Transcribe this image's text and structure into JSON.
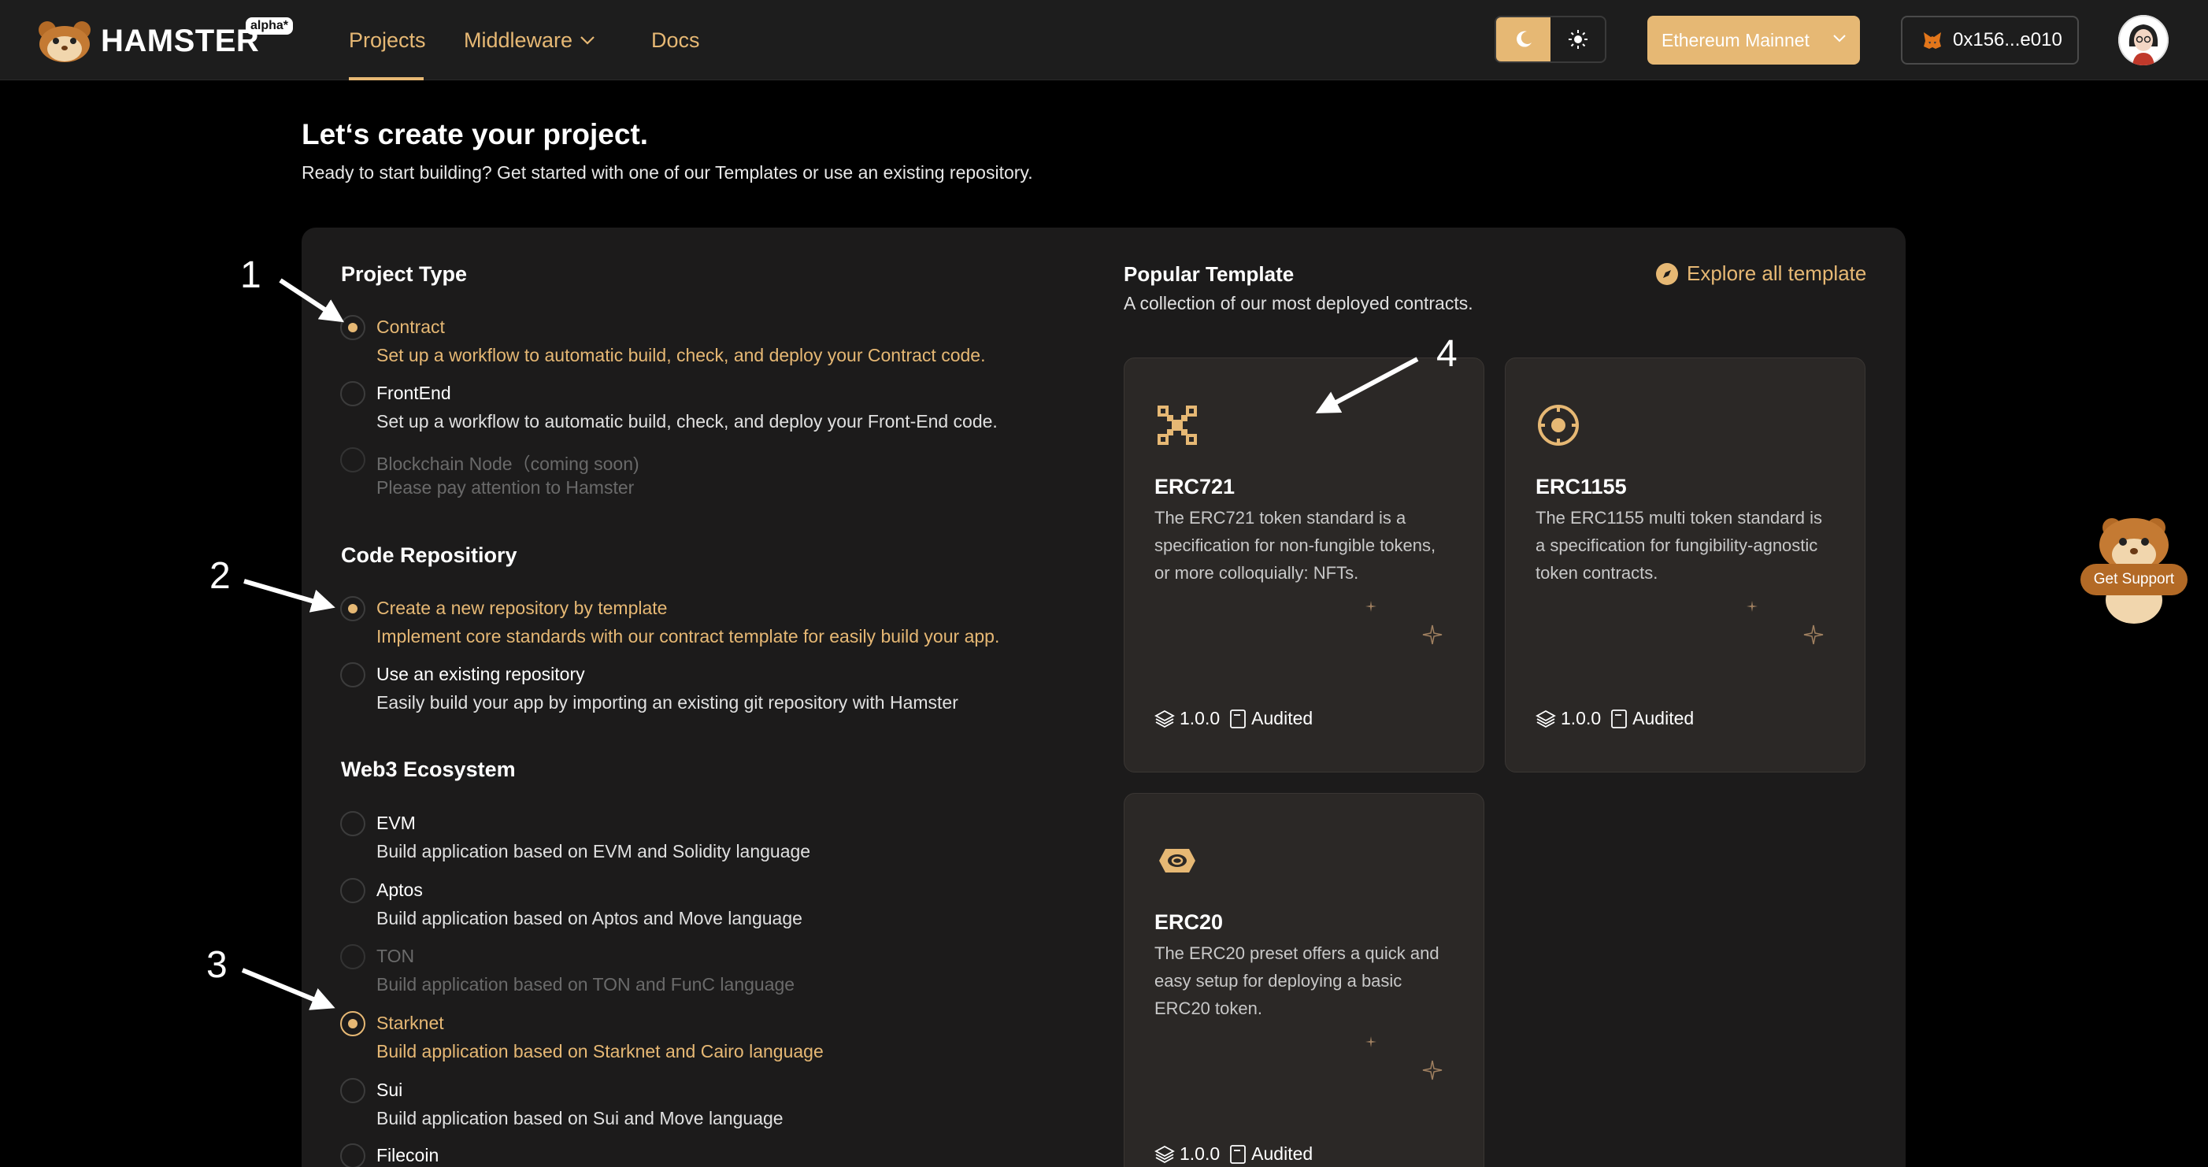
{
  "header": {
    "logo_text": "HAMSTER",
    "logo_badge": "alpha*",
    "nav": {
      "projects": "Projects",
      "middleware": "Middleware",
      "docs": "Docs"
    },
    "network": "Ethereum Mainnet",
    "wallet_address": "0x156...e010"
  },
  "page": {
    "title": "Let‘s create your project.",
    "subtitle": "Ready to start building? Get started with one of our Templates or use an existing repository."
  },
  "project_type": {
    "title": "Project Type",
    "options": [
      {
        "label": "Contract",
        "desc": "Set up a workflow to automatic build, check, and deploy your Contract code."
      },
      {
        "label": "FrontEnd",
        "desc": "Set up a workflow to automatic build, check, and deploy your Front-End code."
      },
      {
        "label": "Blockchain Node（coming soon)",
        "desc": "Please pay attention to Hamster"
      }
    ]
  },
  "code_repository": {
    "title": "Code Repositiory",
    "options": [
      {
        "label": "Create a new repository by template",
        "desc": "Implement core standards with our contract template for easily build your app."
      },
      {
        "label": "Use an existing repository",
        "desc": "Easily build your app by importing an existing git repository with Hamster"
      }
    ]
  },
  "web3": {
    "title": "Web3 Ecosystem",
    "options": [
      {
        "label": "EVM",
        "desc": "Build application based on EVM and Solidity language"
      },
      {
        "label": "Aptos",
        "desc": "Build application based on Aptos and Move language"
      },
      {
        "label": "TON",
        "desc": "Build application based on TON and FunC language"
      },
      {
        "label": "Starknet",
        "desc": "Build application based on Starknet and Cairo language"
      },
      {
        "label": "Sui",
        "desc": "Build application based on Sui and Move language"
      },
      {
        "label": "Filecoin",
        "desc": ""
      }
    ]
  },
  "templates": {
    "title": "Popular Template",
    "subtitle": "A collection of our most deployed contracts.",
    "explore": "Explore all template",
    "cards": [
      {
        "name": "ERC721",
        "desc": "The ERC721 token standard is a specification for non-fungible tokens, or more colloquially: NFTs.",
        "version": "1.0.0",
        "status": "Audited"
      },
      {
        "name": "ERC1155",
        "desc": "The ERC1155 multi token standard is a specification for fungibility-agnostic token contracts.",
        "version": "1.0.0",
        "status": "Audited"
      },
      {
        "name": "ERC20",
        "desc": "The ERC20 preset offers a quick and easy setup for deploying a basic ERC20 token.",
        "version": "1.0.0",
        "status": "Audited"
      }
    ]
  },
  "annotations": [
    "1",
    "2",
    "3",
    "4"
  ],
  "support": {
    "label": "Get Support"
  },
  "colors": {
    "accent": "#e6b874",
    "background": "#000000",
    "panel": "#1c1b1b",
    "card": "#2b2826"
  }
}
